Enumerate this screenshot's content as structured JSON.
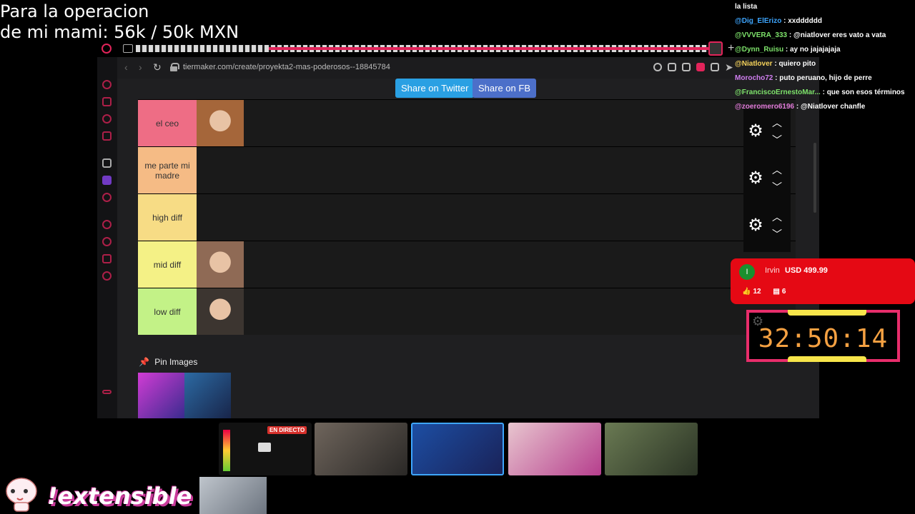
{
  "overlay": {
    "goal_line1": "Para la operacion",
    "goal_line2": "de mi mami: 56k / 50k MXN"
  },
  "browser": {
    "url": "tiermaker.com/create/proyekta2-mas-poderosos--18845784",
    "share_twitter": "Share on Twitter",
    "share_fb": "Share on FB",
    "tiers": [
      {
        "label": "el ceo",
        "color": "#ee6d85",
        "has_image": true
      },
      {
        "label": "me parte mi madre",
        "color": "#f5bb85",
        "has_image": false
      },
      {
        "label": "high diff",
        "color": "#f7dc85",
        "has_image": false
      },
      {
        "label": "mid diff",
        "color": "#f4f186",
        "has_image": true
      },
      {
        "label": "low diff",
        "color": "#c3f287",
        "has_image": true
      }
    ],
    "pin_images": "Pin Images"
  },
  "chat": [
    {
      "user": "@Dig_ElErizo",
      "sep": " : ",
      "text": "xxdddddd",
      "color": "#3ea6ff"
    },
    {
      "user": "@VVVERA_333",
      "sep": " : ",
      "text": "@niatlover eres vato a vata",
      "color": "#7ee36b"
    },
    {
      "user": "@Dynn_Ruisu",
      "sep": " : ",
      "text": "ay no jajajajaja",
      "color": "#7ee36b"
    },
    {
      "user": "@Niatlover",
      "sep": " : ",
      "text": "quiero pito",
      "color": "#f6d35b"
    },
    {
      "user": "Morocho72",
      "sep": " : ",
      "text": "puto peruano, hijo de perre",
      "color": "#d07ef0"
    },
    {
      "user": "@FranciscoErnestoMar...",
      "sep": " : ",
      "text": "que son esos términos",
      "color": "#7ee36b"
    },
    {
      "user": "@zoeromero6196",
      "sep": " : ",
      "text": "@Niatlover chanfle",
      "color": "#e07ad8"
    }
  ],
  "chat_top": {
    "text": "la lista"
  },
  "donation": {
    "avatar": "I",
    "name": "Irvin",
    "amount": "USD 499.99",
    "likes": "12",
    "comments": "6"
  },
  "timer": {
    "value": "32:50:14"
  },
  "thumbnails": {
    "live_badge": "EN DIRECTO"
  },
  "logo": {
    "text": "!extensible"
  }
}
